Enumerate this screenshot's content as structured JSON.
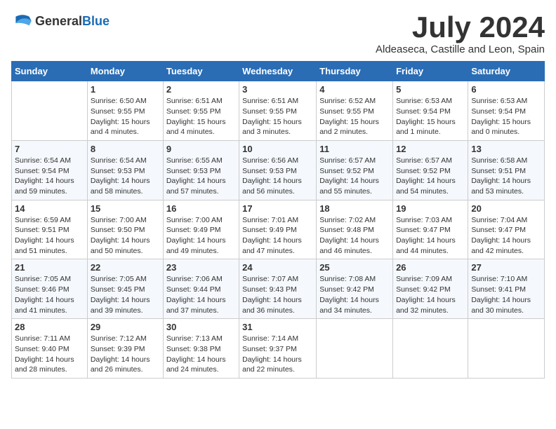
{
  "logo": {
    "text_general": "General",
    "text_blue": "Blue"
  },
  "title": "July 2024",
  "location": "Aldeaseca, Castille and Leon, Spain",
  "days_of_week": [
    "Sunday",
    "Monday",
    "Tuesday",
    "Wednesday",
    "Thursday",
    "Friday",
    "Saturday"
  ],
  "weeks": [
    [
      {
        "day": "",
        "sunrise": "",
        "sunset": "",
        "daylight": ""
      },
      {
        "day": "1",
        "sunrise": "Sunrise: 6:50 AM",
        "sunset": "Sunset: 9:55 PM",
        "daylight": "Daylight: 15 hours and 4 minutes."
      },
      {
        "day": "2",
        "sunrise": "Sunrise: 6:51 AM",
        "sunset": "Sunset: 9:55 PM",
        "daylight": "Daylight: 15 hours and 4 minutes."
      },
      {
        "day": "3",
        "sunrise": "Sunrise: 6:51 AM",
        "sunset": "Sunset: 9:55 PM",
        "daylight": "Daylight: 15 hours and 3 minutes."
      },
      {
        "day": "4",
        "sunrise": "Sunrise: 6:52 AM",
        "sunset": "Sunset: 9:55 PM",
        "daylight": "Daylight: 15 hours and 2 minutes."
      },
      {
        "day": "5",
        "sunrise": "Sunrise: 6:53 AM",
        "sunset": "Sunset: 9:54 PM",
        "daylight": "Daylight: 15 hours and 1 minute."
      },
      {
        "day": "6",
        "sunrise": "Sunrise: 6:53 AM",
        "sunset": "Sunset: 9:54 PM",
        "daylight": "Daylight: 15 hours and 0 minutes."
      }
    ],
    [
      {
        "day": "7",
        "sunrise": "Sunrise: 6:54 AM",
        "sunset": "Sunset: 9:54 PM",
        "daylight": "Daylight: 14 hours and 59 minutes."
      },
      {
        "day": "8",
        "sunrise": "Sunrise: 6:54 AM",
        "sunset": "Sunset: 9:53 PM",
        "daylight": "Daylight: 14 hours and 58 minutes."
      },
      {
        "day": "9",
        "sunrise": "Sunrise: 6:55 AM",
        "sunset": "Sunset: 9:53 PM",
        "daylight": "Daylight: 14 hours and 57 minutes."
      },
      {
        "day": "10",
        "sunrise": "Sunrise: 6:56 AM",
        "sunset": "Sunset: 9:53 PM",
        "daylight": "Daylight: 14 hours and 56 minutes."
      },
      {
        "day": "11",
        "sunrise": "Sunrise: 6:57 AM",
        "sunset": "Sunset: 9:52 PM",
        "daylight": "Daylight: 14 hours and 55 minutes."
      },
      {
        "day": "12",
        "sunrise": "Sunrise: 6:57 AM",
        "sunset": "Sunset: 9:52 PM",
        "daylight": "Daylight: 14 hours and 54 minutes."
      },
      {
        "day": "13",
        "sunrise": "Sunrise: 6:58 AM",
        "sunset": "Sunset: 9:51 PM",
        "daylight": "Daylight: 14 hours and 53 minutes."
      }
    ],
    [
      {
        "day": "14",
        "sunrise": "Sunrise: 6:59 AM",
        "sunset": "Sunset: 9:51 PM",
        "daylight": "Daylight: 14 hours and 51 minutes."
      },
      {
        "day": "15",
        "sunrise": "Sunrise: 7:00 AM",
        "sunset": "Sunset: 9:50 PM",
        "daylight": "Daylight: 14 hours and 50 minutes."
      },
      {
        "day": "16",
        "sunrise": "Sunrise: 7:00 AM",
        "sunset": "Sunset: 9:49 PM",
        "daylight": "Daylight: 14 hours and 49 minutes."
      },
      {
        "day": "17",
        "sunrise": "Sunrise: 7:01 AM",
        "sunset": "Sunset: 9:49 PM",
        "daylight": "Daylight: 14 hours and 47 minutes."
      },
      {
        "day": "18",
        "sunrise": "Sunrise: 7:02 AM",
        "sunset": "Sunset: 9:48 PM",
        "daylight": "Daylight: 14 hours and 46 minutes."
      },
      {
        "day": "19",
        "sunrise": "Sunrise: 7:03 AM",
        "sunset": "Sunset: 9:47 PM",
        "daylight": "Daylight: 14 hours and 44 minutes."
      },
      {
        "day": "20",
        "sunrise": "Sunrise: 7:04 AM",
        "sunset": "Sunset: 9:47 PM",
        "daylight": "Daylight: 14 hours and 42 minutes."
      }
    ],
    [
      {
        "day": "21",
        "sunrise": "Sunrise: 7:05 AM",
        "sunset": "Sunset: 9:46 PM",
        "daylight": "Daylight: 14 hours and 41 minutes."
      },
      {
        "day": "22",
        "sunrise": "Sunrise: 7:05 AM",
        "sunset": "Sunset: 9:45 PM",
        "daylight": "Daylight: 14 hours and 39 minutes."
      },
      {
        "day": "23",
        "sunrise": "Sunrise: 7:06 AM",
        "sunset": "Sunset: 9:44 PM",
        "daylight": "Daylight: 14 hours and 37 minutes."
      },
      {
        "day": "24",
        "sunrise": "Sunrise: 7:07 AM",
        "sunset": "Sunset: 9:43 PM",
        "daylight": "Daylight: 14 hours and 36 minutes."
      },
      {
        "day": "25",
        "sunrise": "Sunrise: 7:08 AM",
        "sunset": "Sunset: 9:42 PM",
        "daylight": "Daylight: 14 hours and 34 minutes."
      },
      {
        "day": "26",
        "sunrise": "Sunrise: 7:09 AM",
        "sunset": "Sunset: 9:42 PM",
        "daylight": "Daylight: 14 hours and 32 minutes."
      },
      {
        "day": "27",
        "sunrise": "Sunrise: 7:10 AM",
        "sunset": "Sunset: 9:41 PM",
        "daylight": "Daylight: 14 hours and 30 minutes."
      }
    ],
    [
      {
        "day": "28",
        "sunrise": "Sunrise: 7:11 AM",
        "sunset": "Sunset: 9:40 PM",
        "daylight": "Daylight: 14 hours and 28 minutes."
      },
      {
        "day": "29",
        "sunrise": "Sunrise: 7:12 AM",
        "sunset": "Sunset: 9:39 PM",
        "daylight": "Daylight: 14 hours and 26 minutes."
      },
      {
        "day": "30",
        "sunrise": "Sunrise: 7:13 AM",
        "sunset": "Sunset: 9:38 PM",
        "daylight": "Daylight: 14 hours and 24 minutes."
      },
      {
        "day": "31",
        "sunrise": "Sunrise: 7:14 AM",
        "sunset": "Sunset: 9:37 PM",
        "daylight": "Daylight: 14 hours and 22 minutes."
      },
      {
        "day": "",
        "sunrise": "",
        "sunset": "",
        "daylight": ""
      },
      {
        "day": "",
        "sunrise": "",
        "sunset": "",
        "daylight": ""
      },
      {
        "day": "",
        "sunrise": "",
        "sunset": "",
        "daylight": ""
      }
    ]
  ]
}
